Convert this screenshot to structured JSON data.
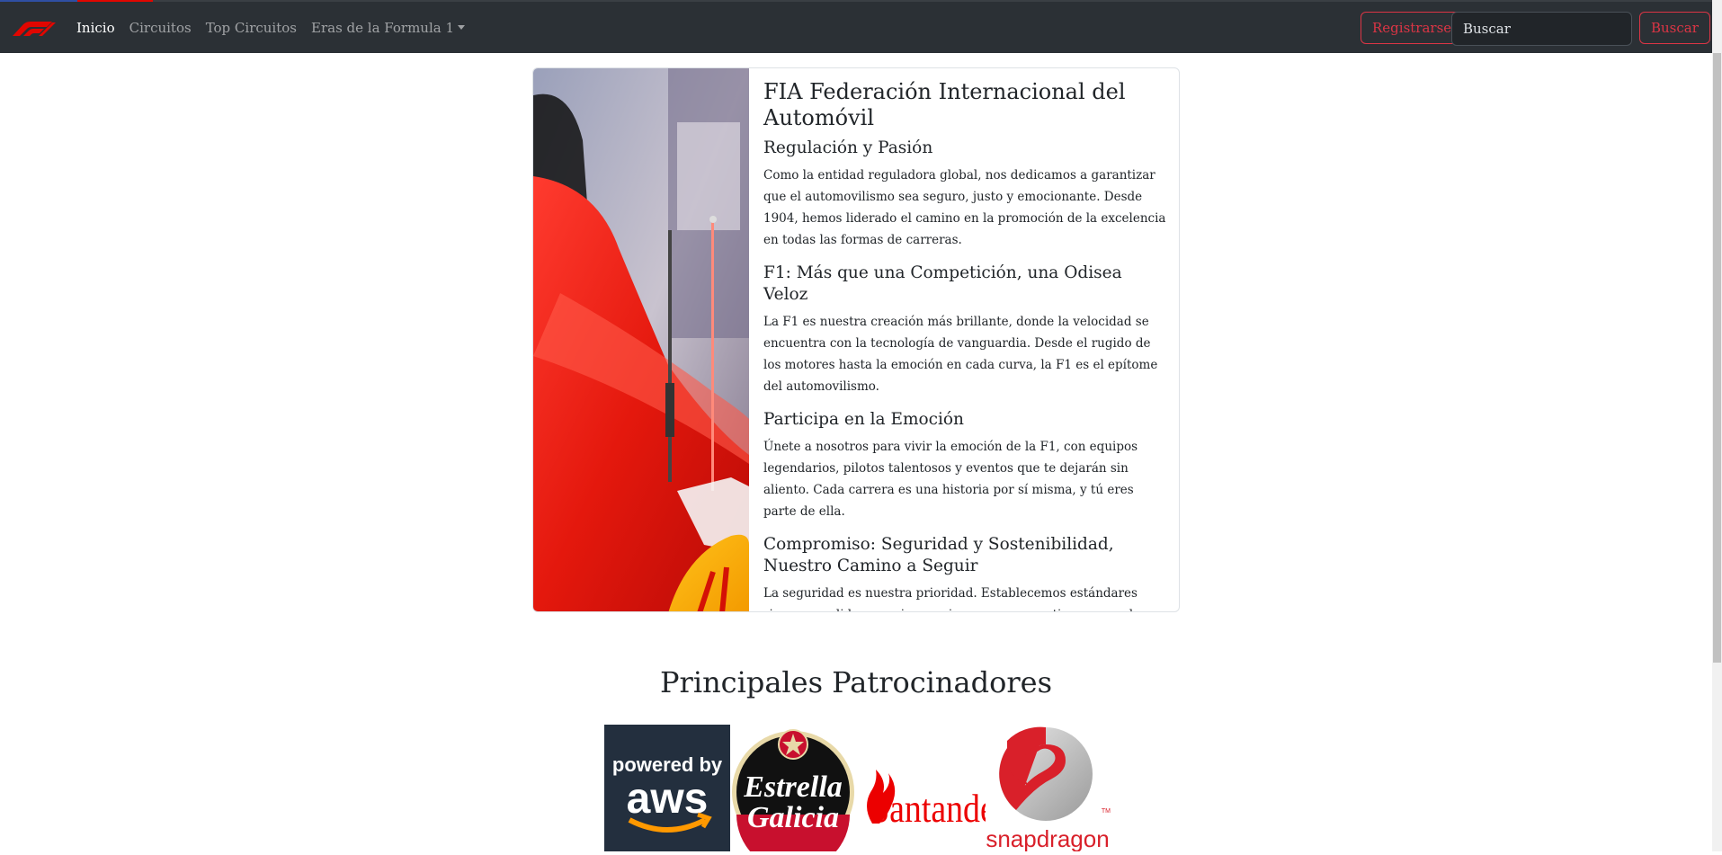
{
  "navbar": {
    "brand_icon": "f1-logo-icon",
    "links": [
      {
        "label": "Inicio",
        "active": true
      },
      {
        "label": "Circuitos",
        "active": false
      },
      {
        "label": "Top Circuitos",
        "active": false
      },
      {
        "label": "Eras de la Formula 1",
        "active": false,
        "dropdown": true
      }
    ],
    "register_label": "Registrarse",
    "search_placeholder": "Buscar",
    "search_button_label": "Buscar"
  },
  "card": {
    "title": "FIA Federación Internacional del Automóvil",
    "sections": [
      {
        "heading": "Regulación y Pasión",
        "text": "Como la entidad reguladora global, nos dedicamos a garantizar que el automovilismo sea seguro, justo y emocionante. Desde 1904, hemos liderado el camino en la promoción de la excelencia en todas las formas de carreras."
      },
      {
        "heading": "F1: Más que una Competición, una Odisea Veloz",
        "text": "La F1 es nuestra creación más brillante, donde la velocidad se encuentra con la tecnología de vanguardia. Desde el rugido de los motores hasta la emoción en cada curva, la F1 es el epítome del automovilismo."
      },
      {
        "heading": "Participa en la Emoción",
        "text": "Únete a nosotros para vivir la emoción de la F1, con equipos legendarios, pilotos talentosos y eventos que te dejarán sin aliento. Cada carrera es una historia por sí misma, y tú eres parte de ella."
      },
      {
        "heading": "Compromiso: Seguridad y Sostenibilidad, Nuestro Camino a Seguir",
        "text": "La seguridad es nuestra prioridad. Establecemos estándares rigurosos y lideramos innovaciones para garantizar que cada carrera sea emocionante y segura. Además, nos esforzamos por un futuro sostenible, explorando prácticas que respeten nuestro planeta."
      }
    ]
  },
  "sponsors": {
    "title": "Principales Patrocinadores",
    "logos": [
      {
        "icon": "aws-logo-icon",
        "text_line1": "powered by",
        "text_line2": "aws"
      },
      {
        "icon": "estrella-galicia-logo-icon",
        "text_line1": "Estrella",
        "text_line2": "Galicia"
      },
      {
        "icon": "santander-logo-icon",
        "text_line1": "Santander"
      },
      {
        "icon": "snapdragon-logo-icon",
        "text_line1": "snapdragon"
      }
    ]
  },
  "colors": {
    "navbar_bg": "#2b3035",
    "accent_red": "#dc3545",
    "f1_red": "#e10600"
  }
}
